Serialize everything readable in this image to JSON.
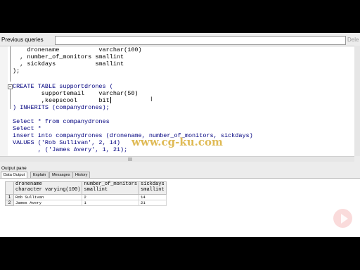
{
  "toolbar": {
    "previous_queries_label": "Previous queries",
    "delete_label": "Dele"
  },
  "editor": {
    "lines": [
      "    dronename           varchar(100)",
      "  , number_of_monitors smallint",
      "  , sickdays           smallint",
      ");",
      "",
      "CREATE TABLE supportdrones (",
      "        supportemail    varchar(50)",
      "        ,keepscool      bit",
      ") INHERITS (companydrones);",
      "",
      "Select * from companydrones",
      "Select *",
      "insert into companydrones (dronename, number_of_monitors, sickdays)",
      "VALUES ('Rob Sullivan', 2, 14)",
      "       , ('James Avery', 1, 21);"
    ]
  },
  "watermark": "www.cg-ku.com",
  "output_pane": {
    "title": "Output pane",
    "tabs": [
      "Data Output",
      "Explain",
      "Messages",
      "History"
    ],
    "active_tab": 0
  },
  "result_grid": {
    "columns": [
      {
        "name": "dronename",
        "type": "character varying(100)"
      },
      {
        "name": "number_of_monitors",
        "type": "smallint"
      },
      {
        "name": "sickdays",
        "type": "smallint"
      }
    ],
    "rows": [
      {
        "num": "1",
        "cells": [
          "Rob Sullivan",
          "2",
          "14"
        ]
      },
      {
        "num": "2",
        "cells": [
          "James Avery",
          "1",
          "21"
        ]
      }
    ]
  }
}
